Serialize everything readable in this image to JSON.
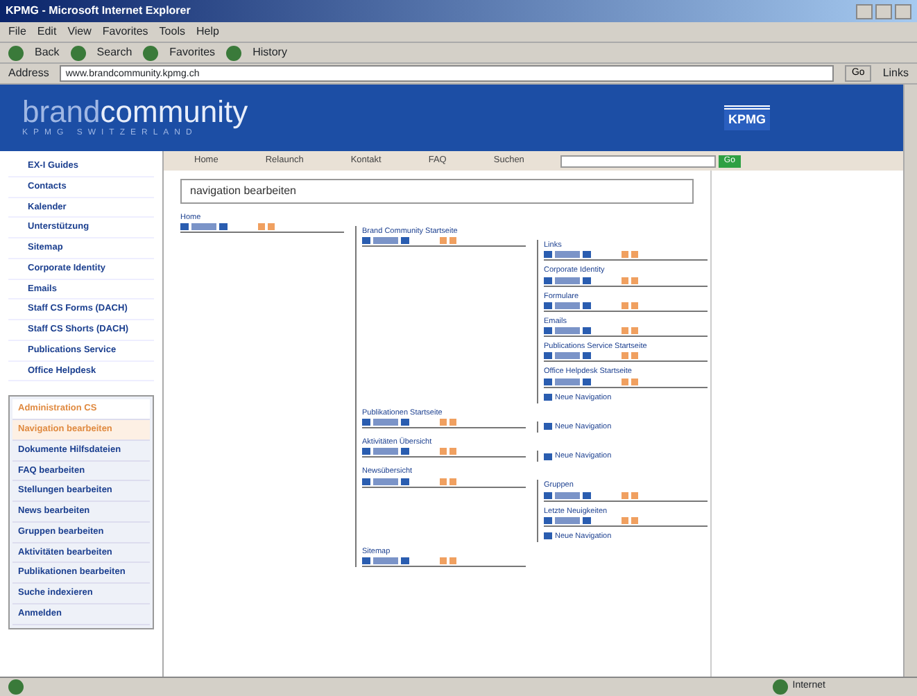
{
  "window": {
    "title": "KPMG - Microsoft Internet Explorer"
  },
  "menu": [
    "File",
    "Edit",
    "View",
    "Favorites",
    "Tools",
    "Help"
  ],
  "toolbar": [
    "Back",
    "Search",
    "Favorites",
    "History"
  ],
  "address": {
    "label": "Address",
    "value": "www.brandcommunity.kpmg.ch",
    "go": "Go",
    "links": "Links"
  },
  "banner": {
    "brand_light": "brand",
    "brand_bold": "community",
    "subtitle": "KPMG SWITZERLAND",
    "logo": "KPMG"
  },
  "nav_tabs": [
    {
      "label": "Home",
      "selected": false
    },
    {
      "label": "Relaunch",
      "selected": false
    },
    {
      "label": "Kontakt",
      "selected": false
    },
    {
      "label": "FAQ",
      "selected": false
    },
    {
      "label": "Suchen",
      "selected": false
    }
  ],
  "search": {
    "button": "Go"
  },
  "sidebar": {
    "items": [
      "EX-I Guides",
      "Contacts",
      "Kalender",
      "Unterstützung",
      "Sitemap",
      "Corporate Identity",
      "Emails",
      "Staff CS Forms (DACH)",
      "Staff CS Shorts (DACH)",
      "Publications Service",
      "Office Helpdesk"
    ],
    "admin_items": [
      {
        "label": "Administration CS",
        "selected": false,
        "kind": "heading"
      },
      {
        "label": "Navigation bearbeiten",
        "selected": true,
        "kind": "link"
      },
      {
        "label": "Dokumente Hilfsdateien",
        "selected": false,
        "kind": "link"
      },
      {
        "label": "FAQ bearbeiten",
        "selected": false,
        "kind": "link"
      },
      {
        "label": "Stellungen bearbeiten",
        "selected": false,
        "kind": "link"
      },
      {
        "label": "News bearbeiten",
        "selected": false,
        "kind": "link"
      },
      {
        "label": "Gruppen bearbeiten",
        "selected": false,
        "kind": "link"
      },
      {
        "label": "Aktivitäten bearbeiten",
        "selected": false,
        "kind": "link"
      },
      {
        "label": "Publikationen bearbeiten",
        "selected": false,
        "kind": "link"
      },
      {
        "label": "Suche indexieren",
        "selected": false,
        "kind": "link"
      },
      {
        "label": "Anmelden",
        "selected": false,
        "kind": "link"
      }
    ]
  },
  "page_title": "navigation bearbeiten",
  "tree": {
    "label": "Home",
    "kind": "node",
    "children": [
      {
        "label": "Brand Community Startseite",
        "kind": "node",
        "children": [
          {
            "label": "Links",
            "kind": "node"
          },
          {
            "label": "Corporate Identity",
            "kind": "node"
          },
          {
            "label": "Formulare",
            "kind": "node"
          },
          {
            "label": "Emails",
            "kind": "node"
          },
          {
            "label": "Publications Service Startseite",
            "kind": "node"
          },
          {
            "label": "Office Helpdesk Startseite",
            "kind": "node"
          },
          {
            "label": "Neue Navigation",
            "kind": "new"
          }
        ]
      },
      {
        "label": "Publikationen Startseite",
        "kind": "node",
        "children": [
          {
            "label": "Neue Navigation",
            "kind": "new"
          }
        ]
      },
      {
        "label": "Aktivitäten Übersicht",
        "kind": "node",
        "children": [
          {
            "label": "Neue Navigation",
            "kind": "new"
          }
        ]
      },
      {
        "label": "Newsübersicht",
        "kind": "node",
        "children": [
          {
            "label": "Gruppen",
            "kind": "node"
          },
          {
            "label": "Letzte Neuigkeiten",
            "kind": "node"
          },
          {
            "label": "Neue Navigation",
            "kind": "new"
          }
        ]
      },
      {
        "label": "Sitemap",
        "kind": "node"
      }
    ]
  },
  "status_bar": {
    "zone": "Internet"
  }
}
